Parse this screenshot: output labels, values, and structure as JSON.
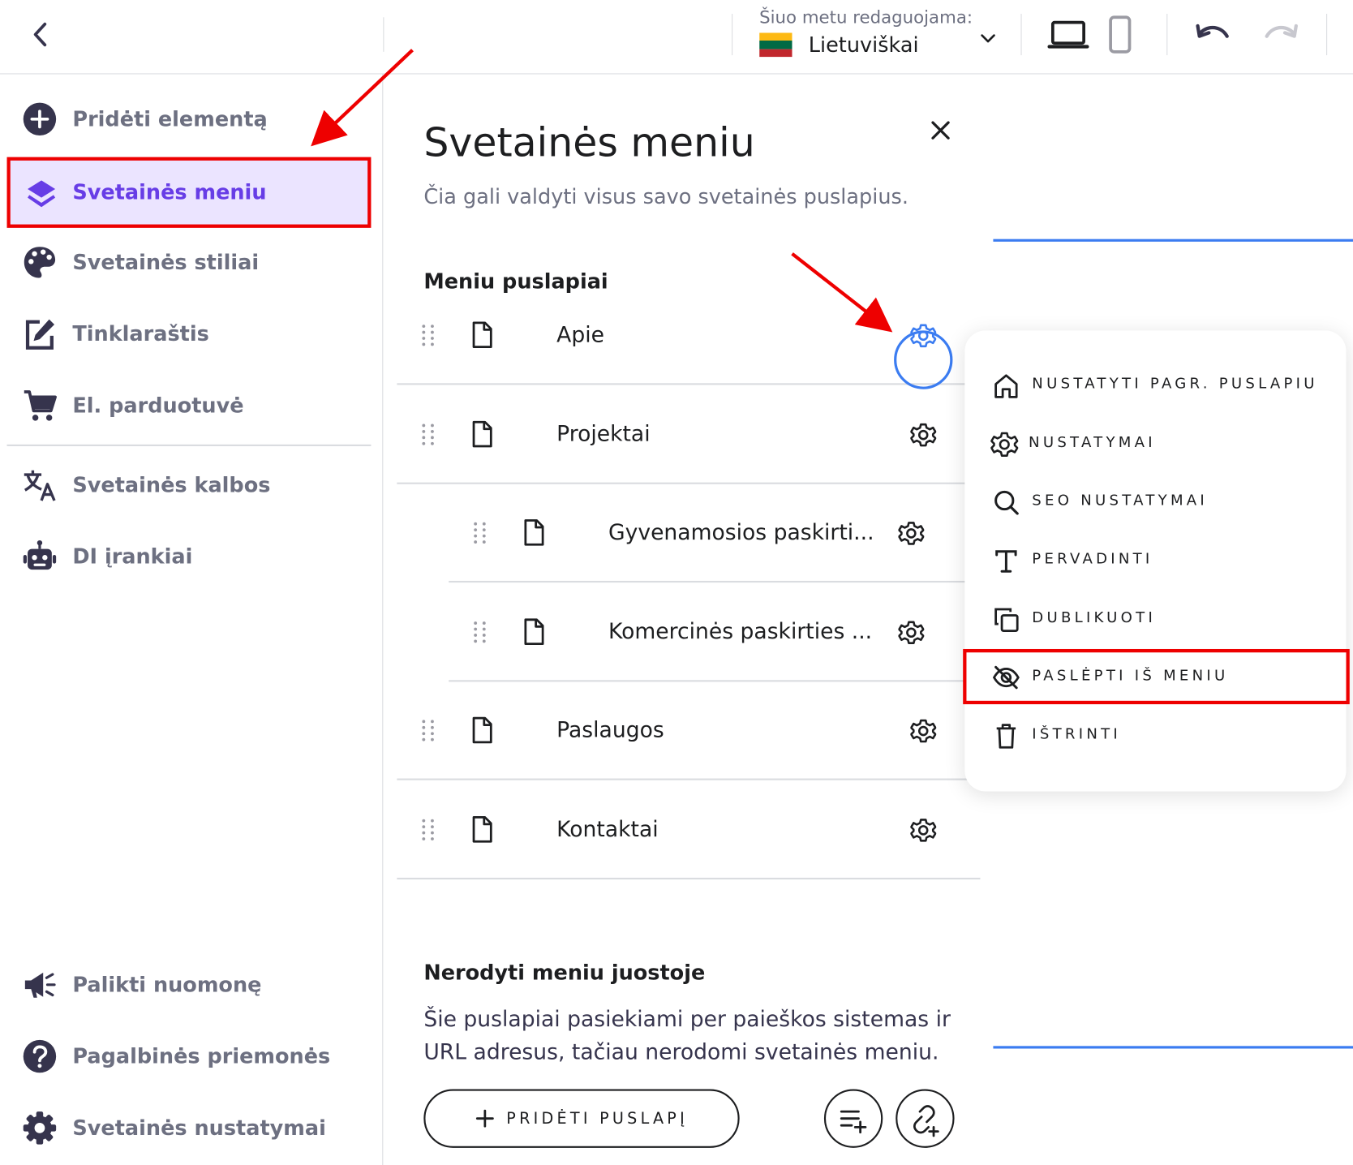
{
  "topbar": {
    "editing_label": "Šiuo metu redaguojama:",
    "language": "Lietuviškai",
    "icons": [
      "back-icon",
      "chevron-down-icon",
      "desktop-icon",
      "mobile-icon",
      "undo-icon",
      "redo-icon"
    ]
  },
  "sidebar": {
    "items": [
      {
        "label": "Pridėti elementą",
        "icon": "plus-circle-icon"
      },
      {
        "label": "Svetainės meniu",
        "icon": "layers-icon",
        "active": true
      },
      {
        "label": "Svetainės stiliai",
        "icon": "palette-icon"
      },
      {
        "label": "Tinklaraštis",
        "icon": "edit-icon"
      },
      {
        "label": "El. parduotuvė",
        "icon": "cart-icon"
      },
      {
        "label": "Svetainės kalbos",
        "icon": "translate-icon"
      },
      {
        "label": "DI įrankiai",
        "icon": "robot-icon"
      }
    ],
    "bottom_items": [
      {
        "label": "Palikti nuomonę",
        "icon": "megaphone-icon"
      },
      {
        "label": "Pagalbinės priemonės",
        "icon": "help-icon"
      },
      {
        "label": "Svetainės nustatymai",
        "icon": "gear-icon"
      }
    ]
  },
  "panel": {
    "title": "Svetainės meniu",
    "subtitle": "Čia gali valdyti visus savo svetainės puslapius.",
    "menu_section_title": "Meniu puslapiai",
    "pages": [
      {
        "name": "Apie",
        "level": 0,
        "gear_highlighted": true
      },
      {
        "name": "Projektai",
        "level": 0
      },
      {
        "name": "Gyvenamosios paskirti...",
        "level": 1
      },
      {
        "name": "Komercinės paskirties ...",
        "level": 1
      },
      {
        "name": "Paslaugos",
        "level": 0
      },
      {
        "name": "Kontaktai",
        "level": 0
      }
    ],
    "hidden_section_title": "Nerodyti meniu juostoje",
    "hidden_section_desc": "Šie puslapiai pasiekiami per paieškos sistemas ir URL adresus, tačiau nerodomi svetainės meniu.",
    "add_page_label": "PRIDĖTI PUSLAPĮ"
  },
  "context_menu": {
    "items": [
      {
        "label": "NUSTATYTI PAGR. PUSLAPIU",
        "icon": "home-icon"
      },
      {
        "label": "NUSTATYMAI",
        "icon": "gear-icon"
      },
      {
        "label": "SEO NUSTATYMAI",
        "icon": "search-icon"
      },
      {
        "label": "PERVADINTI",
        "icon": "text-icon"
      },
      {
        "label": "DUBLIKUOTI",
        "icon": "duplicate-icon"
      },
      {
        "label": "PASLĖPTI IŠ MENIU",
        "icon": "eye-off-icon",
        "highlighted": true
      },
      {
        "label": "IŠTRINTI",
        "icon": "trash-icon"
      }
    ]
  },
  "colors": {
    "accent": "#673de6",
    "active_bg": "#ebe4ff",
    "highlight": "#ee0000",
    "blue": "#3b7cf1",
    "muted_text": "#6d7081"
  }
}
